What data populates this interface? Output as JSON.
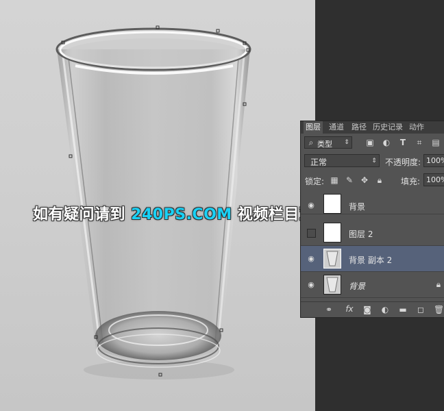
{
  "colors": {
    "watermark_accent": "#19d1f5",
    "selected_layer": "#56627a",
    "panel_bg": "#535353"
  },
  "panel_tabs": [
    "图层",
    "通道",
    "路径",
    "历史记录",
    "动作"
  ],
  "filter": {
    "label": "类型",
    "icons": [
      "image-filter-icon",
      "adjustment-filter-icon",
      "type-filter-icon",
      "shape-filter-icon",
      "smart-object-filter-icon"
    ]
  },
  "blend": {
    "mode": "正常",
    "opacity_label": "不透明度:",
    "opacity_value": "100%"
  },
  "lock": {
    "label": "锁定:",
    "fill_label": "填充:",
    "fill_value": "100%"
  },
  "layers": [
    {
      "name": "背景",
      "visible": true,
      "selected": false
    },
    {
      "name": "图层 2",
      "visible": false,
      "selected": false
    },
    {
      "name": "背景 副本 2",
      "visible": true,
      "selected": true
    },
    {
      "name": "背景",
      "visible": true,
      "selected": false,
      "locked": true
    }
  ],
  "watermark": {
    "before": "如有疑问请到 ",
    "site": "240PS.COM",
    "after": " 视频栏目观看视频教程"
  }
}
